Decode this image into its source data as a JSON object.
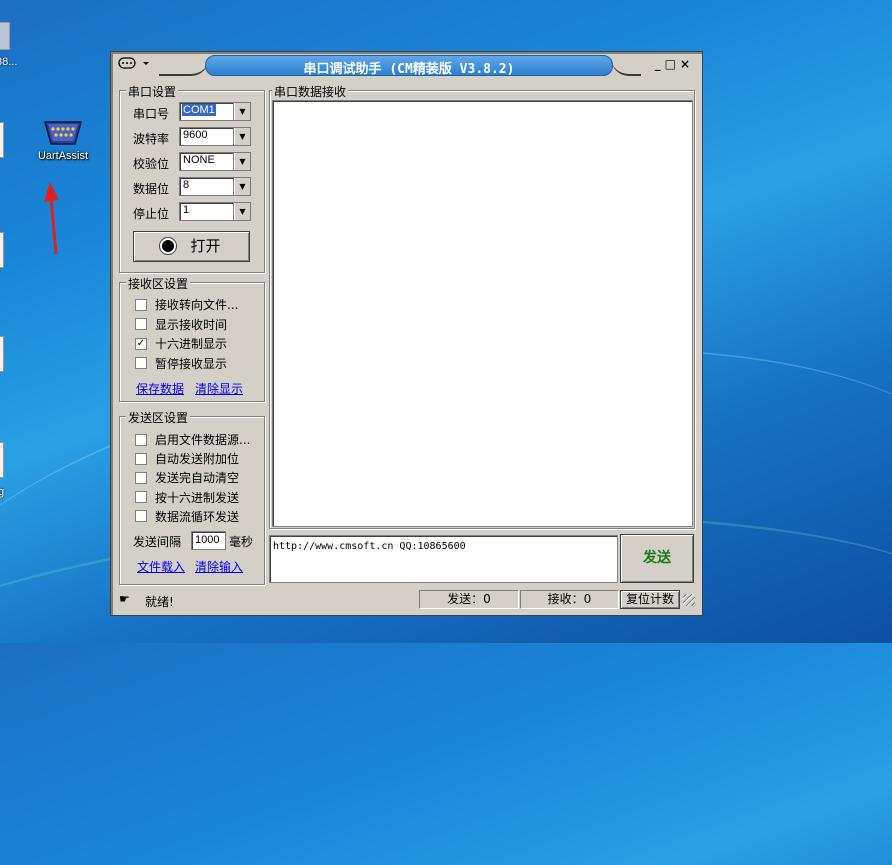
{
  "desktop": {
    "uart_icon_label": "UartAssist",
    "edge_fragment_text": "38...",
    "edge_fragment_text2": "g"
  },
  "window": {
    "title": "串口调试助手 (CM精装版 V3.8.2)",
    "controls": {
      "minimize": "_",
      "maximize": "□",
      "close": "×"
    }
  },
  "port_settings": {
    "group_title": "串口设置",
    "fields": [
      {
        "label": "串口号",
        "value": "COM1",
        "selected": true
      },
      {
        "label": "波特率",
        "value": "9600"
      },
      {
        "label": "校验位",
        "value": "NONE"
      },
      {
        "label": "数据位",
        "value": "8"
      },
      {
        "label": "停止位",
        "value": "1"
      }
    ],
    "open_button_label": "打开"
  },
  "receive_settings": {
    "group_title": "接收区设置",
    "options": [
      {
        "label": "接收转向文件...",
        "checked": false
      },
      {
        "label": "显示接收时间",
        "checked": false
      },
      {
        "label": "十六进制显示",
        "checked": true
      },
      {
        "label": "暂停接收显示",
        "checked": false
      }
    ],
    "links": {
      "save": "保存数据",
      "clear": "清除显示"
    }
  },
  "send_settings": {
    "group_title": "发送区设置",
    "options": [
      {
        "label": "启用文件数据源...",
        "checked": false
      },
      {
        "label": "自动发送附加位",
        "checked": false
      },
      {
        "label": "发送完自动清空",
        "checked": false
      },
      {
        "label": "按十六进制发送",
        "checked": false
      },
      {
        "label": "数据流循环发送",
        "checked": false
      }
    ],
    "interval_label": "发送间隔",
    "interval_value": "1000",
    "interval_unit": "毫秒",
    "links": {
      "load": "文件载入",
      "clear": "清除输入"
    }
  },
  "receive_area": {
    "group_title": "串口数据接收",
    "content": ""
  },
  "send_area": {
    "content": "http://www.cmsoft.cn QQ:10865600",
    "send_button_label": "发送"
  },
  "status_bar": {
    "status_text": "就绪!",
    "sent": "发送：0",
    "received": "接收：0",
    "reset_label": "复位计数"
  },
  "colors": {
    "title_bar": "#2d7fd0",
    "send_button_text": "#1a7a1a",
    "link": "#0000ee",
    "selection": "#3169c6"
  }
}
